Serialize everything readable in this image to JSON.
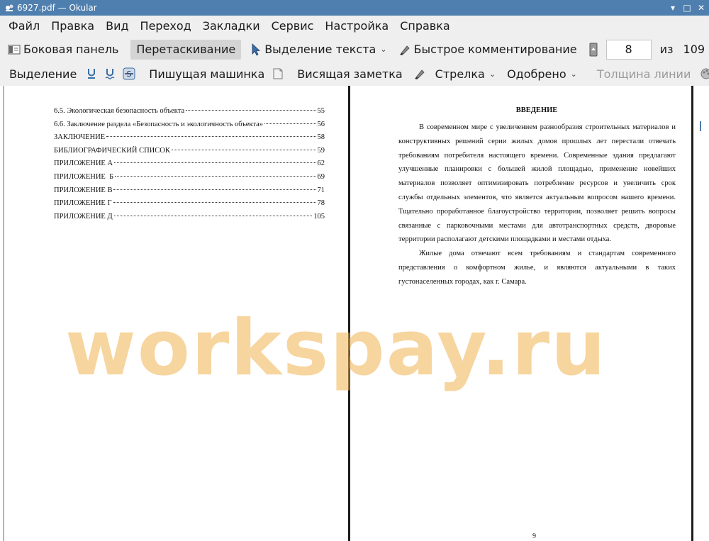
{
  "window": {
    "title": "6927.pdf  — Okular",
    "controls": {
      "minimize": "▾",
      "maximize": "□",
      "close": "✕"
    }
  },
  "menu": [
    "Файл",
    "Правка",
    "Вид",
    "Переход",
    "Закладки",
    "Сервис",
    "Настройка",
    "Справка"
  ],
  "toolbar1": {
    "sidebar": "Боковая панель",
    "browse": "Перетаскивание",
    "text_select": "Выделение текста",
    "quick_annotate": "Быстрое комментирование",
    "page_current": "8",
    "page_of": "из",
    "page_total": "109"
  },
  "toolbar2": {
    "highlight": "Выделение",
    "typewriter": "Пишущая машинка",
    "inline_note": "Висящая заметка",
    "arrow": "Стрелка",
    "stamp": "Одобрено",
    "line_width": "Толщина линии"
  },
  "toc": [
    {
      "title": "6.5. Экологическая безопасность объекта",
      "page": "55"
    },
    {
      "title": "6.6. Заключение раздела «Безопасность и экологичность объекта»",
      "page": "56"
    },
    {
      "title": "ЗАКЛЮЧЕНИЕ",
      "page": "58"
    },
    {
      "title": "БИБЛИОГРАФИЧЕСКИЙ СПИСОК",
      "page": "59"
    },
    {
      "title": "ПРИЛОЖЕНИЕ А",
      "page": "62"
    },
    {
      "title": "ПРИЛОЖЕНИЕ  Б",
      "page": "69"
    },
    {
      "title": "ПРИЛОЖЕНИЕ В",
      "page": "71"
    },
    {
      "title": "ПРИЛОЖЕНИЕ Г",
      "page": "78"
    },
    {
      "title": "ПРИЛОЖЕНИЕ Д",
      "page": "105"
    }
  ],
  "intro": {
    "heading": "ВВЕДЕНИЕ",
    "p1": "В современном мире с увеличением разнообразия строительных материалов и конструктивных решений серии жилых домов прошлых лет перестали отвечать требованиям потребителя настоящего времени. Современные здания предлагают улучшенные планировки с большей жилой площадью, применение новейших материалов позволяет оптимизировать потребление ресурсов и увеличить срок службы отдельных элементов, что является актуальным вопросом нашего времени. Тщательно проработанное благоустройство территории, позволяет решить вопросы связанные с парковочными местами для автотранспортных средств, дворовые территории располагают детскими площадками и местами отдыха.",
    "p2": "Жилые дома отвечают всем требованиям и стандартам современного представления о комфортном жилье, и являются актуальными в таких густонаселенных городах, как г. Самара.",
    "page_number": "9"
  },
  "watermark": "workspay.ru",
  "colors": {
    "titlebar": "#4f7fae",
    "toolbar": "#efefef",
    "watermark": "#f0b24e"
  }
}
